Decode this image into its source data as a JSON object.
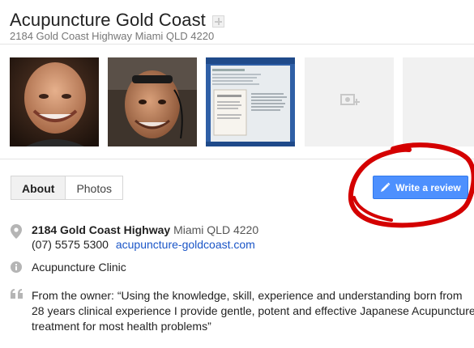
{
  "business": {
    "name": "Acupuncture Gold Coast",
    "address_header": "2184 Gold Coast Highway Miami QLD 4220"
  },
  "photos": [
    {
      "label": "portrait-photo-1"
    },
    {
      "label": "portrait-photo-2"
    },
    {
      "label": "document-photo"
    },
    {
      "label": "add-photo-placeholder"
    },
    {
      "label": "empty-photo-slot"
    }
  ],
  "tabs": [
    {
      "label": "About",
      "active": true
    },
    {
      "label": "Photos",
      "active": false
    }
  ],
  "actions": {
    "write_review": "Write a review"
  },
  "details": {
    "address_street": "2184 Gold Coast Highway",
    "address_locality": "Miami QLD 4220",
    "phone": "(07) 5575 5300",
    "website": "acupuncture-goldcoast.com",
    "category": "Acupuncture Clinic",
    "owner_quote": "From the owner: “Using the knowledge, skill, experience and understanding born from 28 years clinical experience I provide gentle, potent and effective Japanese Acupuncture treatment for most health problems”"
  },
  "colors": {
    "accent_blue": "#4d90fe",
    "link_blue": "#1a55c7",
    "annotation_red": "#d40000"
  }
}
